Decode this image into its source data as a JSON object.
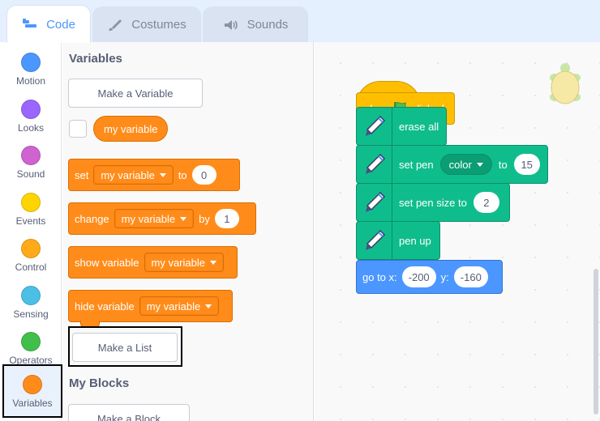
{
  "tabs": [
    {
      "label": "Code",
      "icon": "code-icon",
      "active": true
    },
    {
      "label": "Costumes",
      "icon": "brush-icon",
      "active": false
    },
    {
      "label": "Sounds",
      "icon": "speaker-icon",
      "active": false
    }
  ],
  "categories": [
    {
      "label": "Motion",
      "color": "#4c97ff"
    },
    {
      "label": "Looks",
      "color": "#9966ff"
    },
    {
      "label": "Sound",
      "color": "#cf63cf"
    },
    {
      "label": "Events",
      "color": "#ffd500"
    },
    {
      "label": "Control",
      "color": "#ffab19"
    },
    {
      "label": "Sensing",
      "color": "#4cbfe6"
    },
    {
      "label": "Operators",
      "color": "#40bf4a"
    },
    {
      "label": "Variables",
      "color": "#ff8c1a",
      "selected": true
    }
  ],
  "palette": {
    "variables_title": "Variables",
    "make_variable": "Make a Variable",
    "variable_reporter": "my variable",
    "set_block": {
      "label": "set",
      "var": "my variable",
      "to": "to",
      "value": "0"
    },
    "change_block": {
      "label": "change",
      "var": "my variable",
      "by": "by",
      "value": "1"
    },
    "show_block": {
      "label": "show variable",
      "var": "my variable"
    },
    "hide_block": {
      "label": "hide variable",
      "var": "my variable"
    },
    "make_list": "Make a List",
    "my_blocks_title": "My Blocks",
    "make_block": "Make a Block"
  },
  "script": {
    "hat": {
      "when": "when",
      "clicked": "clicked"
    },
    "erase_all": "erase all",
    "set_pen": {
      "label": "set pen",
      "param": "color",
      "to": "to",
      "value": "15"
    },
    "set_pen_size": {
      "label": "set pen size to",
      "value": "2"
    },
    "pen_up": "pen up",
    "go_to": {
      "label": "go to x:",
      "x": "-200",
      "y_label": "y:",
      "y": "-160"
    }
  }
}
